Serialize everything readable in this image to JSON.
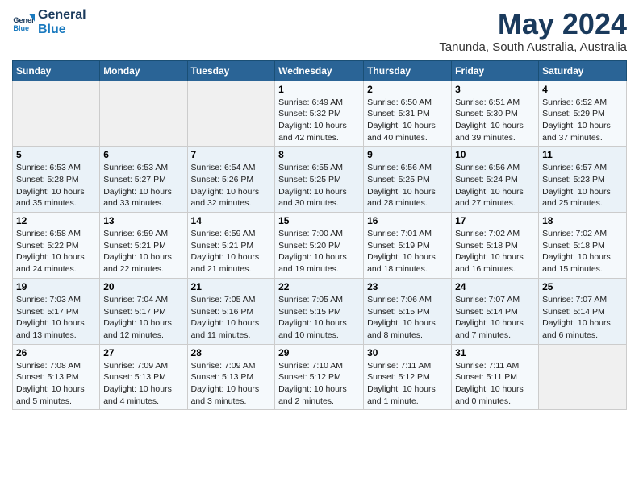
{
  "header": {
    "logo_line1": "General",
    "logo_line2": "Blue",
    "title": "May 2024",
    "subtitle": "Tanunda, South Australia, Australia"
  },
  "calendar": {
    "days_of_week": [
      "Sunday",
      "Monday",
      "Tuesday",
      "Wednesday",
      "Thursday",
      "Friday",
      "Saturday"
    ],
    "weeks": [
      [
        {
          "day": "",
          "sunrise": "",
          "sunset": "",
          "daylight": ""
        },
        {
          "day": "",
          "sunrise": "",
          "sunset": "",
          "daylight": ""
        },
        {
          "day": "",
          "sunrise": "",
          "sunset": "",
          "daylight": ""
        },
        {
          "day": "1",
          "sunrise": "Sunrise: 6:49 AM",
          "sunset": "Sunset: 5:32 PM",
          "daylight": "Daylight: 10 hours and 42 minutes."
        },
        {
          "day": "2",
          "sunrise": "Sunrise: 6:50 AM",
          "sunset": "Sunset: 5:31 PM",
          "daylight": "Daylight: 10 hours and 40 minutes."
        },
        {
          "day": "3",
          "sunrise": "Sunrise: 6:51 AM",
          "sunset": "Sunset: 5:30 PM",
          "daylight": "Daylight: 10 hours and 39 minutes."
        },
        {
          "day": "4",
          "sunrise": "Sunrise: 6:52 AM",
          "sunset": "Sunset: 5:29 PM",
          "daylight": "Daylight: 10 hours and 37 minutes."
        }
      ],
      [
        {
          "day": "5",
          "sunrise": "Sunrise: 6:53 AM",
          "sunset": "Sunset: 5:28 PM",
          "daylight": "Daylight: 10 hours and 35 minutes."
        },
        {
          "day": "6",
          "sunrise": "Sunrise: 6:53 AM",
          "sunset": "Sunset: 5:27 PM",
          "daylight": "Daylight: 10 hours and 33 minutes."
        },
        {
          "day": "7",
          "sunrise": "Sunrise: 6:54 AM",
          "sunset": "Sunset: 5:26 PM",
          "daylight": "Daylight: 10 hours and 32 minutes."
        },
        {
          "day": "8",
          "sunrise": "Sunrise: 6:55 AM",
          "sunset": "Sunset: 5:25 PM",
          "daylight": "Daylight: 10 hours and 30 minutes."
        },
        {
          "day": "9",
          "sunrise": "Sunrise: 6:56 AM",
          "sunset": "Sunset: 5:25 PM",
          "daylight": "Daylight: 10 hours and 28 minutes."
        },
        {
          "day": "10",
          "sunrise": "Sunrise: 6:56 AM",
          "sunset": "Sunset: 5:24 PM",
          "daylight": "Daylight: 10 hours and 27 minutes."
        },
        {
          "day": "11",
          "sunrise": "Sunrise: 6:57 AM",
          "sunset": "Sunset: 5:23 PM",
          "daylight": "Daylight: 10 hours and 25 minutes."
        }
      ],
      [
        {
          "day": "12",
          "sunrise": "Sunrise: 6:58 AM",
          "sunset": "Sunset: 5:22 PM",
          "daylight": "Daylight: 10 hours and 24 minutes."
        },
        {
          "day": "13",
          "sunrise": "Sunrise: 6:59 AM",
          "sunset": "Sunset: 5:21 PM",
          "daylight": "Daylight: 10 hours and 22 minutes."
        },
        {
          "day": "14",
          "sunrise": "Sunrise: 6:59 AM",
          "sunset": "Sunset: 5:21 PM",
          "daylight": "Daylight: 10 hours and 21 minutes."
        },
        {
          "day": "15",
          "sunrise": "Sunrise: 7:00 AM",
          "sunset": "Sunset: 5:20 PM",
          "daylight": "Daylight: 10 hours and 19 minutes."
        },
        {
          "day": "16",
          "sunrise": "Sunrise: 7:01 AM",
          "sunset": "Sunset: 5:19 PM",
          "daylight": "Daylight: 10 hours and 18 minutes."
        },
        {
          "day": "17",
          "sunrise": "Sunrise: 7:02 AM",
          "sunset": "Sunset: 5:18 PM",
          "daylight": "Daylight: 10 hours and 16 minutes."
        },
        {
          "day": "18",
          "sunrise": "Sunrise: 7:02 AM",
          "sunset": "Sunset: 5:18 PM",
          "daylight": "Daylight: 10 hours and 15 minutes."
        }
      ],
      [
        {
          "day": "19",
          "sunrise": "Sunrise: 7:03 AM",
          "sunset": "Sunset: 5:17 PM",
          "daylight": "Daylight: 10 hours and 13 minutes."
        },
        {
          "day": "20",
          "sunrise": "Sunrise: 7:04 AM",
          "sunset": "Sunset: 5:17 PM",
          "daylight": "Daylight: 10 hours and 12 minutes."
        },
        {
          "day": "21",
          "sunrise": "Sunrise: 7:05 AM",
          "sunset": "Sunset: 5:16 PM",
          "daylight": "Daylight: 10 hours and 11 minutes."
        },
        {
          "day": "22",
          "sunrise": "Sunrise: 7:05 AM",
          "sunset": "Sunset: 5:15 PM",
          "daylight": "Daylight: 10 hours and 10 minutes."
        },
        {
          "day": "23",
          "sunrise": "Sunrise: 7:06 AM",
          "sunset": "Sunset: 5:15 PM",
          "daylight": "Daylight: 10 hours and 8 minutes."
        },
        {
          "day": "24",
          "sunrise": "Sunrise: 7:07 AM",
          "sunset": "Sunset: 5:14 PM",
          "daylight": "Daylight: 10 hours and 7 minutes."
        },
        {
          "day": "25",
          "sunrise": "Sunrise: 7:07 AM",
          "sunset": "Sunset: 5:14 PM",
          "daylight": "Daylight: 10 hours and 6 minutes."
        }
      ],
      [
        {
          "day": "26",
          "sunrise": "Sunrise: 7:08 AM",
          "sunset": "Sunset: 5:13 PM",
          "daylight": "Daylight: 10 hours and 5 minutes."
        },
        {
          "day": "27",
          "sunrise": "Sunrise: 7:09 AM",
          "sunset": "Sunset: 5:13 PM",
          "daylight": "Daylight: 10 hours and 4 minutes."
        },
        {
          "day": "28",
          "sunrise": "Sunrise: 7:09 AM",
          "sunset": "Sunset: 5:13 PM",
          "daylight": "Daylight: 10 hours and 3 minutes."
        },
        {
          "day": "29",
          "sunrise": "Sunrise: 7:10 AM",
          "sunset": "Sunset: 5:12 PM",
          "daylight": "Daylight: 10 hours and 2 minutes."
        },
        {
          "day": "30",
          "sunrise": "Sunrise: 7:11 AM",
          "sunset": "Sunset: 5:12 PM",
          "daylight": "Daylight: 10 hours and 1 minute."
        },
        {
          "day": "31",
          "sunrise": "Sunrise: 7:11 AM",
          "sunset": "Sunset: 5:11 PM",
          "daylight": "Daylight: 10 hours and 0 minutes."
        },
        {
          "day": "",
          "sunrise": "",
          "sunset": "",
          "daylight": ""
        }
      ]
    ]
  }
}
